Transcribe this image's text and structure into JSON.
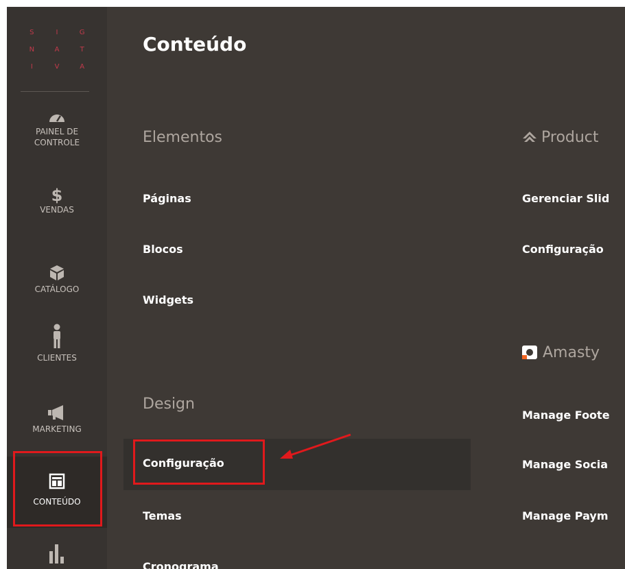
{
  "logo": {
    "letters": [
      "S",
      "I",
      "G",
      "N",
      "A",
      "T",
      "I",
      "V",
      "A"
    ]
  },
  "sidebar": {
    "items": [
      {
        "label_line1": "PAINEL DE",
        "label_line2": "CONTROLE",
        "icon": "dashboard-icon"
      },
      {
        "label": "VENDAS",
        "icon": "dollar-icon"
      },
      {
        "label": "CATÁLOGO",
        "icon": "box-icon"
      },
      {
        "label": "CLIENTES",
        "icon": "person-icon"
      },
      {
        "label": "MARKETING",
        "icon": "megaphone-icon"
      },
      {
        "label": "CONTEÚDO",
        "icon": "layout-icon",
        "active": true
      },
      {
        "label": "",
        "icon": "bar-chart-icon"
      }
    ]
  },
  "main": {
    "title": "Conteúdo",
    "sections": [
      {
        "title": "Elementos",
        "links": [
          "Páginas",
          "Blocos",
          "Widgets"
        ]
      },
      {
        "title": "Design",
        "links": [
          "Configuração",
          "Temas",
          "Cronograma"
        ]
      },
      {
        "title": "Product",
        "links": [
          "Gerenciar Slid",
          "Configuração"
        ]
      },
      {
        "title": "Amasty",
        "links": [
          "Manage Foote",
          "Manage Socia",
          "Manage Paym"
        ]
      }
    ]
  },
  "colors": {
    "accent_red": "#e0191c",
    "logo_red": "#c23a4b",
    "sidebar_bg": "#373330",
    "panel_bg": "#3e3935"
  }
}
